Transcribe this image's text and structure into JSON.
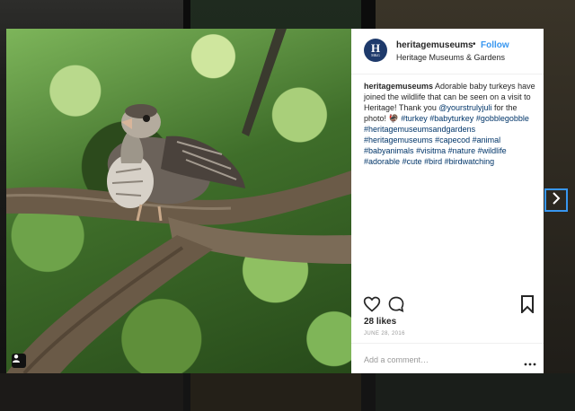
{
  "post": {
    "username": "heritagemuseums",
    "follow_dot": "•",
    "follow_label": "Follow",
    "location": "Heritage Museums & Gardens",
    "avatar": {
      "big": "H",
      "small": "M&G"
    },
    "caption": {
      "username": "heritagemuseums",
      "text": " Adorable baby turkeys have joined the wildlife that can be seen on a visit to Heritage! Thank you ",
      "mention": "@yourstrulyjuli",
      "text2": " for the photo! 🦃 ",
      "hashtags": [
        "#turkey",
        "#babyturkey",
        "#gobblegobble",
        "#heritagemuseumsandgardens",
        "#heritagemuseums",
        "#capecod",
        "#animal",
        "#babyanimals",
        "#visitma",
        "#nature",
        "#wildlife",
        "#adorable",
        "#cute",
        "#bird",
        "#birdwatching"
      ]
    },
    "likes": "28 likes",
    "date": "JUNE 28, 2016",
    "comment_placeholder": "Add a comment…"
  },
  "icons": {
    "like": "heart-icon",
    "comment": "comment-icon",
    "save": "bookmark-icon",
    "more": "more-options-icon",
    "next": "chevron-right-icon",
    "user_tag": "user-tag-icon"
  },
  "colors": {
    "follow": "#3897f0",
    "hashtag": "#003569",
    "avatar_bg": "#1e3a6b",
    "next_border": "#3897f0"
  }
}
